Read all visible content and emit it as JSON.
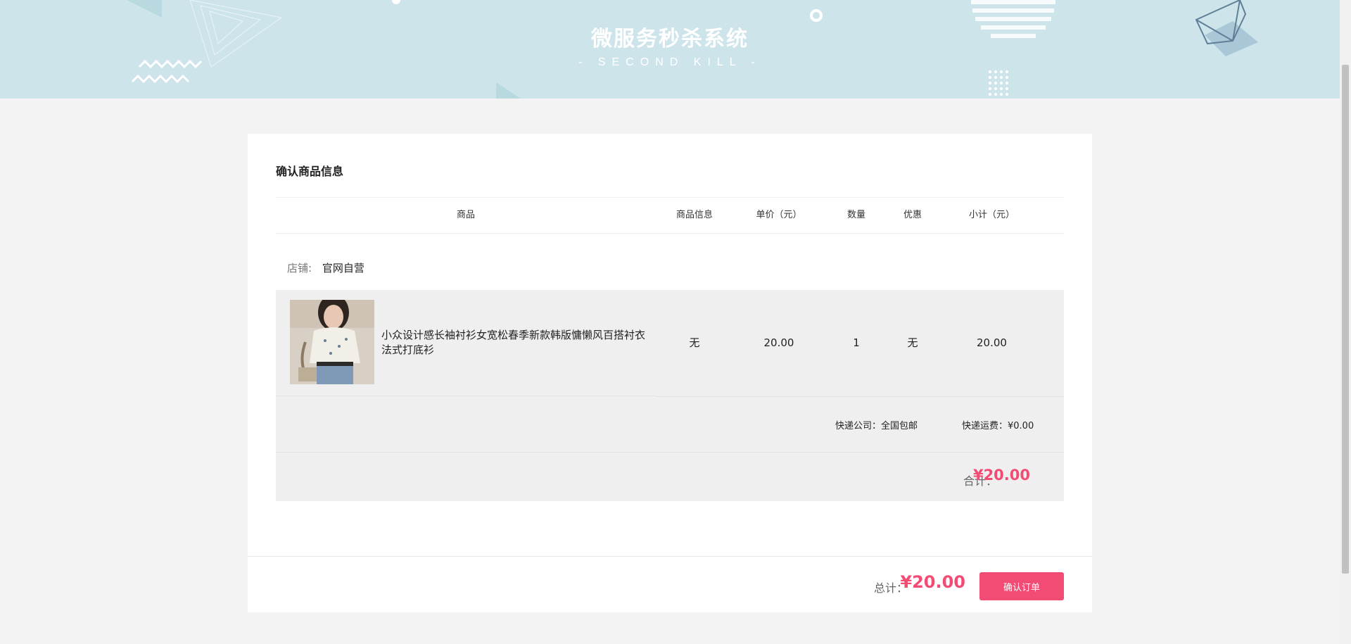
{
  "header": {
    "title": "微服务秒杀系统",
    "subtitle": "- SECOND KILL -"
  },
  "order": {
    "section_title": "确认商品信息",
    "columns": [
      "商品",
      "商品信息",
      "单价（元）",
      "数量",
      "优惠",
      "小计（元）"
    ],
    "shop_label": "店铺:",
    "shop_name": "官网自营",
    "item": {
      "name": "小众设计感长袖衬衫女宽松春季新款韩版慵懒风百搭衬衣法式打底衫",
      "info": "无",
      "price": "20.00",
      "quantity": "1",
      "discount": "无",
      "subtotal": "20.00"
    },
    "shipping_company": "快递公司：全国包邮",
    "shipping_fee": "快递运费：¥0.00",
    "total_label": "合计：",
    "total_value": "¥20.00"
  },
  "footer": {
    "grand_label": "总计：",
    "grand_value": "¥20.00",
    "confirm_label": "确认订单"
  },
  "colors": {
    "accent": "#f24b74",
    "banner": "#cde5ea"
  }
}
